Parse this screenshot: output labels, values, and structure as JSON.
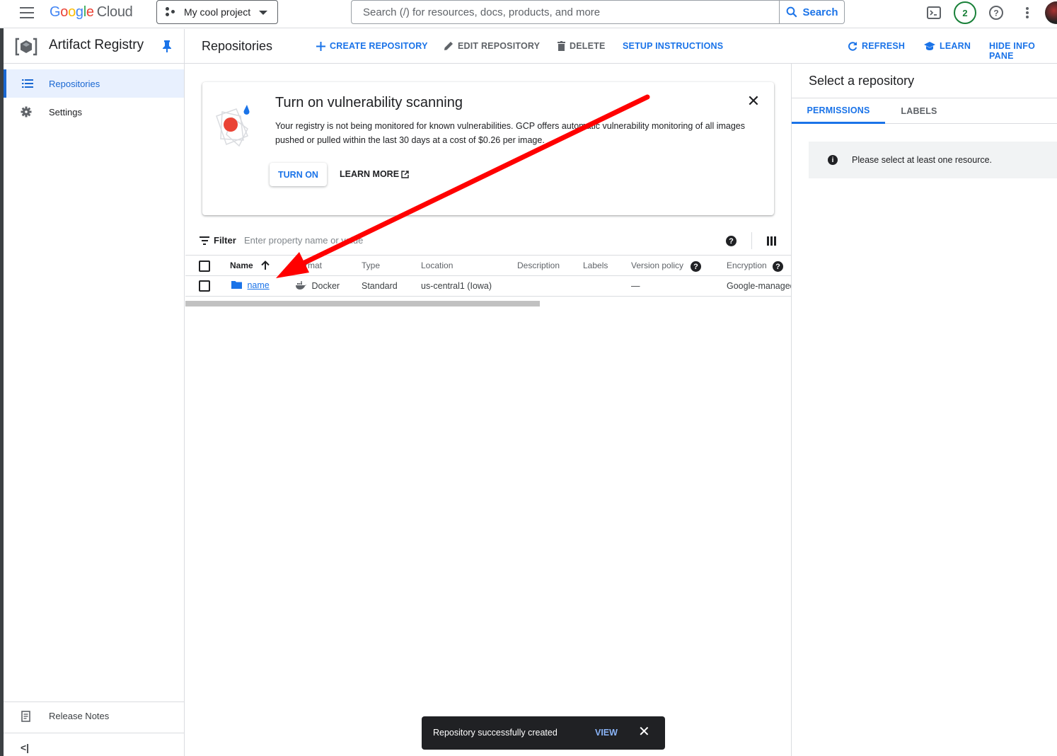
{
  "topbar": {
    "logo_google": [
      "G",
      "o",
      "o",
      "g",
      "l",
      "e"
    ],
    "logo_cloud": "Cloud",
    "project_name": "My cool project",
    "search_placeholder": "Search (/) for resources, docs, products, and more",
    "search_button": "Search",
    "notification_count": "2"
  },
  "nav": {
    "product_title": "Artifact Registry",
    "items": [
      {
        "label": "Repositories",
        "icon": "list-icon"
      },
      {
        "label": "Settings",
        "icon": "gear-icon"
      }
    ],
    "release_notes": "Release Notes",
    "collapse_label": "<|"
  },
  "toolbar": {
    "page_title": "Repositories",
    "create": "CREATE REPOSITORY",
    "edit": "EDIT REPOSITORY",
    "delete": "DELETE",
    "setup": "SETUP INSTRUCTIONS",
    "refresh": "REFRESH",
    "learn": "LEARN",
    "hide_info": "HIDE INFO PANE"
  },
  "banner": {
    "title": "Turn on vulnerability scanning",
    "text": "Your registry is not being monitored for known vulnerabilities. GCP offers automatic vulnerability monitoring of all images pushed or pulled within the last 30 days at a cost of $0.26 per image.",
    "turn_on": "TURN ON",
    "learn_more": "LEARN MORE"
  },
  "filter": {
    "label": "Filter",
    "placeholder": "Enter property name or value"
  },
  "table": {
    "headers": {
      "name": "Name",
      "format": "Format",
      "type": "Type",
      "location": "Location",
      "description": "Description",
      "labels": "Labels",
      "version_policy": "Version policy",
      "encryption": "Encryption"
    },
    "rows": [
      {
        "name": "name",
        "format": "Docker",
        "type": "Standard",
        "location": "us-central1 (Iowa)",
        "description": "",
        "labels": "",
        "version_policy": "—",
        "encryption": "Google-managed"
      }
    ]
  },
  "info_panel": {
    "title": "Select a repository",
    "tabs": [
      "PERMISSIONS",
      "LABELS"
    ],
    "message": "Please select at least one resource."
  },
  "snackbar": {
    "text": "Repository successfully created",
    "action": "VIEW"
  },
  "colors": {
    "accent": "#1a73e8",
    "annotation_arrow": "#ff0000",
    "badge_green": "#188038"
  }
}
